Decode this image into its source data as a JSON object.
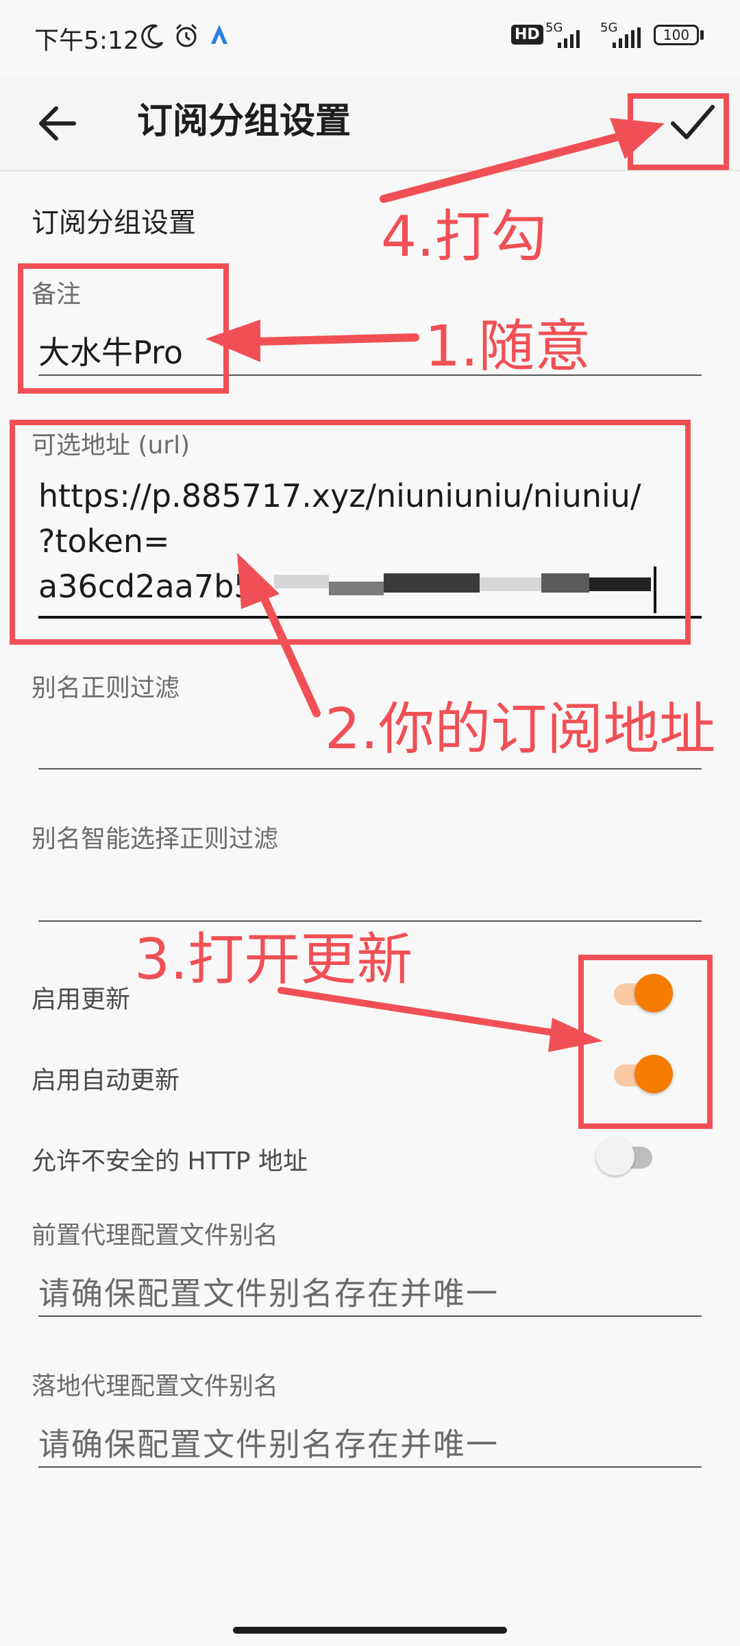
{
  "status_bar": {
    "time": "下午5:12",
    "battery": "100",
    "network_1": "5G",
    "network_2": "5G",
    "hd_badge": "HD"
  },
  "app_bar": {
    "title": "订阅分组设置",
    "back_icon": "arrow-left-icon",
    "confirm_icon": "check-icon"
  },
  "form": {
    "section_title": "订阅分组设置",
    "remark": {
      "label": "备注",
      "value": "大水牛Pro"
    },
    "url": {
      "label": "可选地址 (url)",
      "line1": "https://p.885717.xyz/niuniuniu/niuniu/",
      "line2": "?token=",
      "line3": "a36cd2aa7b5"
    },
    "alias_filter": {
      "label": "别名正则过滤",
      "value": ""
    },
    "alias_smart_filter": {
      "label": "别名智能选择正则过滤",
      "value": ""
    },
    "enable_update": {
      "label": "启用更新",
      "on": true
    },
    "enable_auto_update": {
      "label": "启用自动更新",
      "on": true
    },
    "allow_insecure_http": {
      "label": "允许不安全的 HTTP 地址",
      "on": false
    },
    "front_proxy": {
      "label": "前置代理配置文件别名",
      "placeholder": "请确保配置文件别名存在并唯一"
    },
    "landing_proxy": {
      "label": "落地代理配置文件别名",
      "placeholder": "请确保配置文件别名存在并唯一"
    }
  },
  "annotations": {
    "step1": "1.随意",
    "step2": "2.你的订阅地址",
    "step3": "3.打开更新",
    "step4": "4.打勾"
  },
  "colors": {
    "accent": "#f57c00",
    "annotation": "#f05055"
  }
}
